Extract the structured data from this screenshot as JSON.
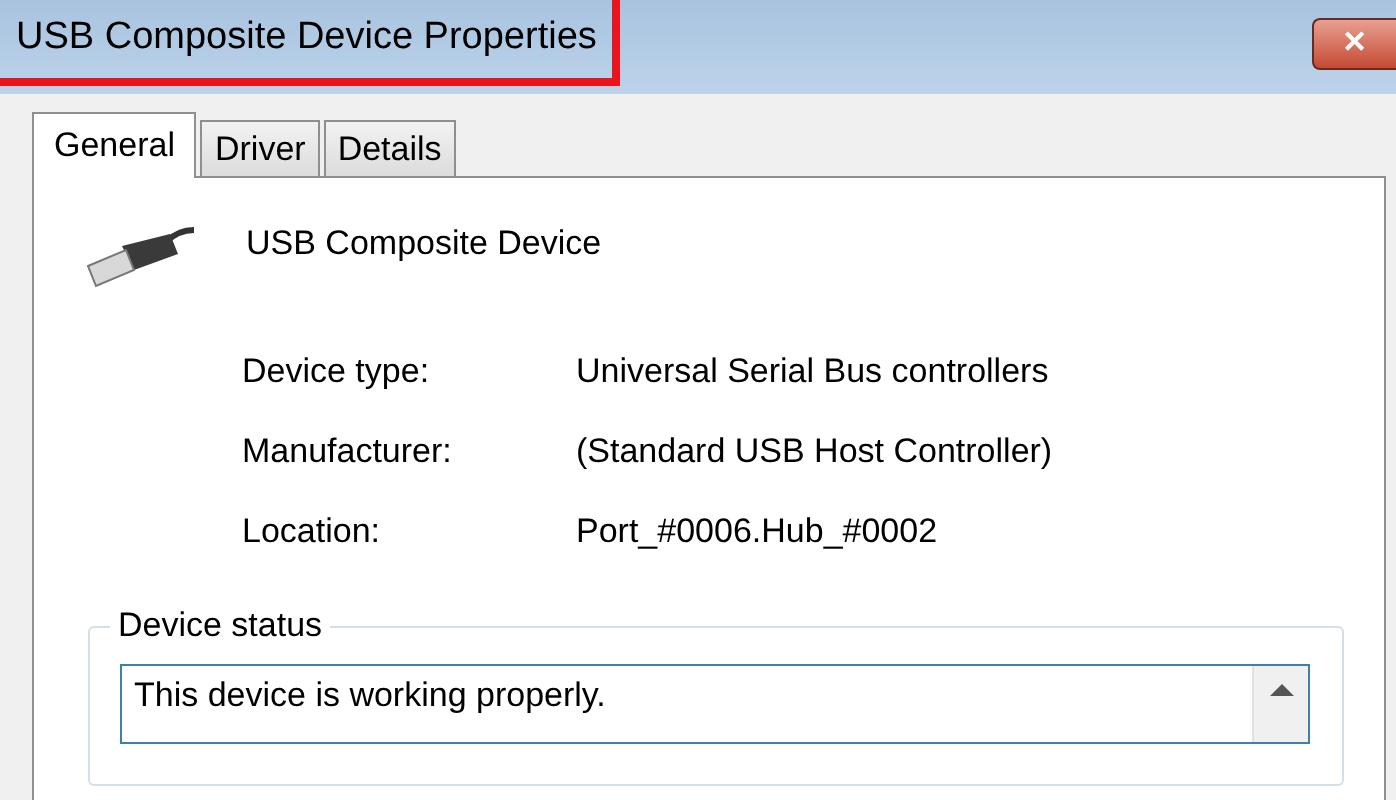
{
  "window": {
    "title": "USB Composite Device Properties",
    "title_highlighted": true,
    "close_label": "✕"
  },
  "tabs": [
    {
      "label": "General",
      "selected": true
    },
    {
      "label": "Driver",
      "selected": false
    },
    {
      "label": "Details",
      "selected": false
    }
  ],
  "device_name": "USB Composite Device",
  "properties": [
    {
      "label": "Device type:",
      "value": "Universal Serial Bus controllers"
    },
    {
      "label": "Manufacturer:",
      "value": "(Standard USB Host Controller)"
    },
    {
      "label": "Location:",
      "value": "Port_#0006.Hub_#0002"
    }
  ],
  "status_group": {
    "legend": "Device status",
    "text": "This device is working properly."
  }
}
